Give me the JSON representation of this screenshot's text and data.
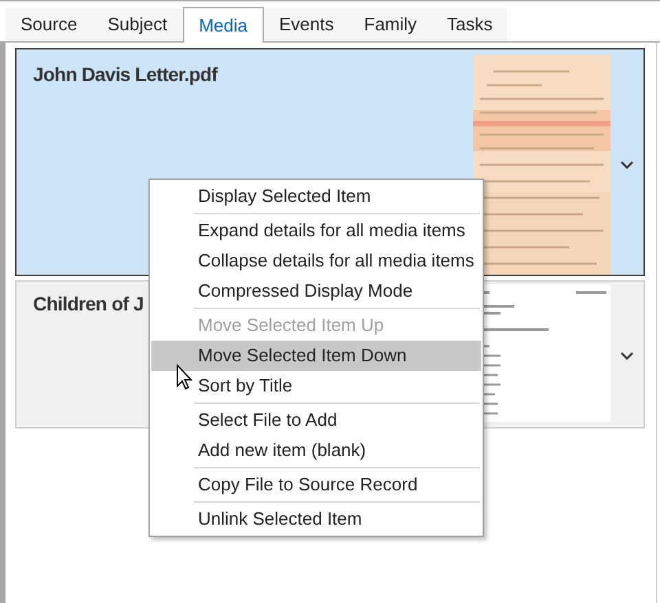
{
  "tabs": [
    {
      "label": "Source",
      "selected": false
    },
    {
      "label": "Subject",
      "selected": false
    },
    {
      "label": "Media",
      "selected": true
    },
    {
      "label": "Events",
      "selected": false
    },
    {
      "label": "Family",
      "selected": false
    },
    {
      "label": "Tasks",
      "selected": false
    }
  ],
  "media_items": [
    {
      "title": "John Davis Letter.pdf",
      "selected": true
    },
    {
      "title": "Children of J",
      "selected": false
    }
  ],
  "context_menu": [
    {
      "label": "Display Selected Item",
      "disabled": false,
      "selected": false,
      "separator_after": true
    },
    {
      "label": "Expand details for all media items",
      "disabled": false,
      "selected": false,
      "separator_after": false
    },
    {
      "label": "Collapse details for all media items",
      "disabled": false,
      "selected": false,
      "separator_after": false
    },
    {
      "label": "Compressed Display Mode",
      "disabled": false,
      "selected": false,
      "separator_after": true
    },
    {
      "label": "Move Selected Item Up",
      "disabled": true,
      "selected": false,
      "separator_after": false
    },
    {
      "label": "Move Selected Item Down",
      "disabled": false,
      "selected": true,
      "separator_after": false
    },
    {
      "label": "Sort by Title",
      "disabled": false,
      "selected": false,
      "separator_after": true
    },
    {
      "label": "Select File to Add",
      "disabled": false,
      "selected": false,
      "separator_after": false
    },
    {
      "label": "Add new item (blank)",
      "disabled": false,
      "selected": false,
      "separator_after": true
    },
    {
      "label": "Copy File to Source Record",
      "disabled": false,
      "selected": false,
      "separator_after": true
    },
    {
      "label": "Unlink Selected Item",
      "disabled": false,
      "selected": false,
      "separator_after": false
    }
  ]
}
